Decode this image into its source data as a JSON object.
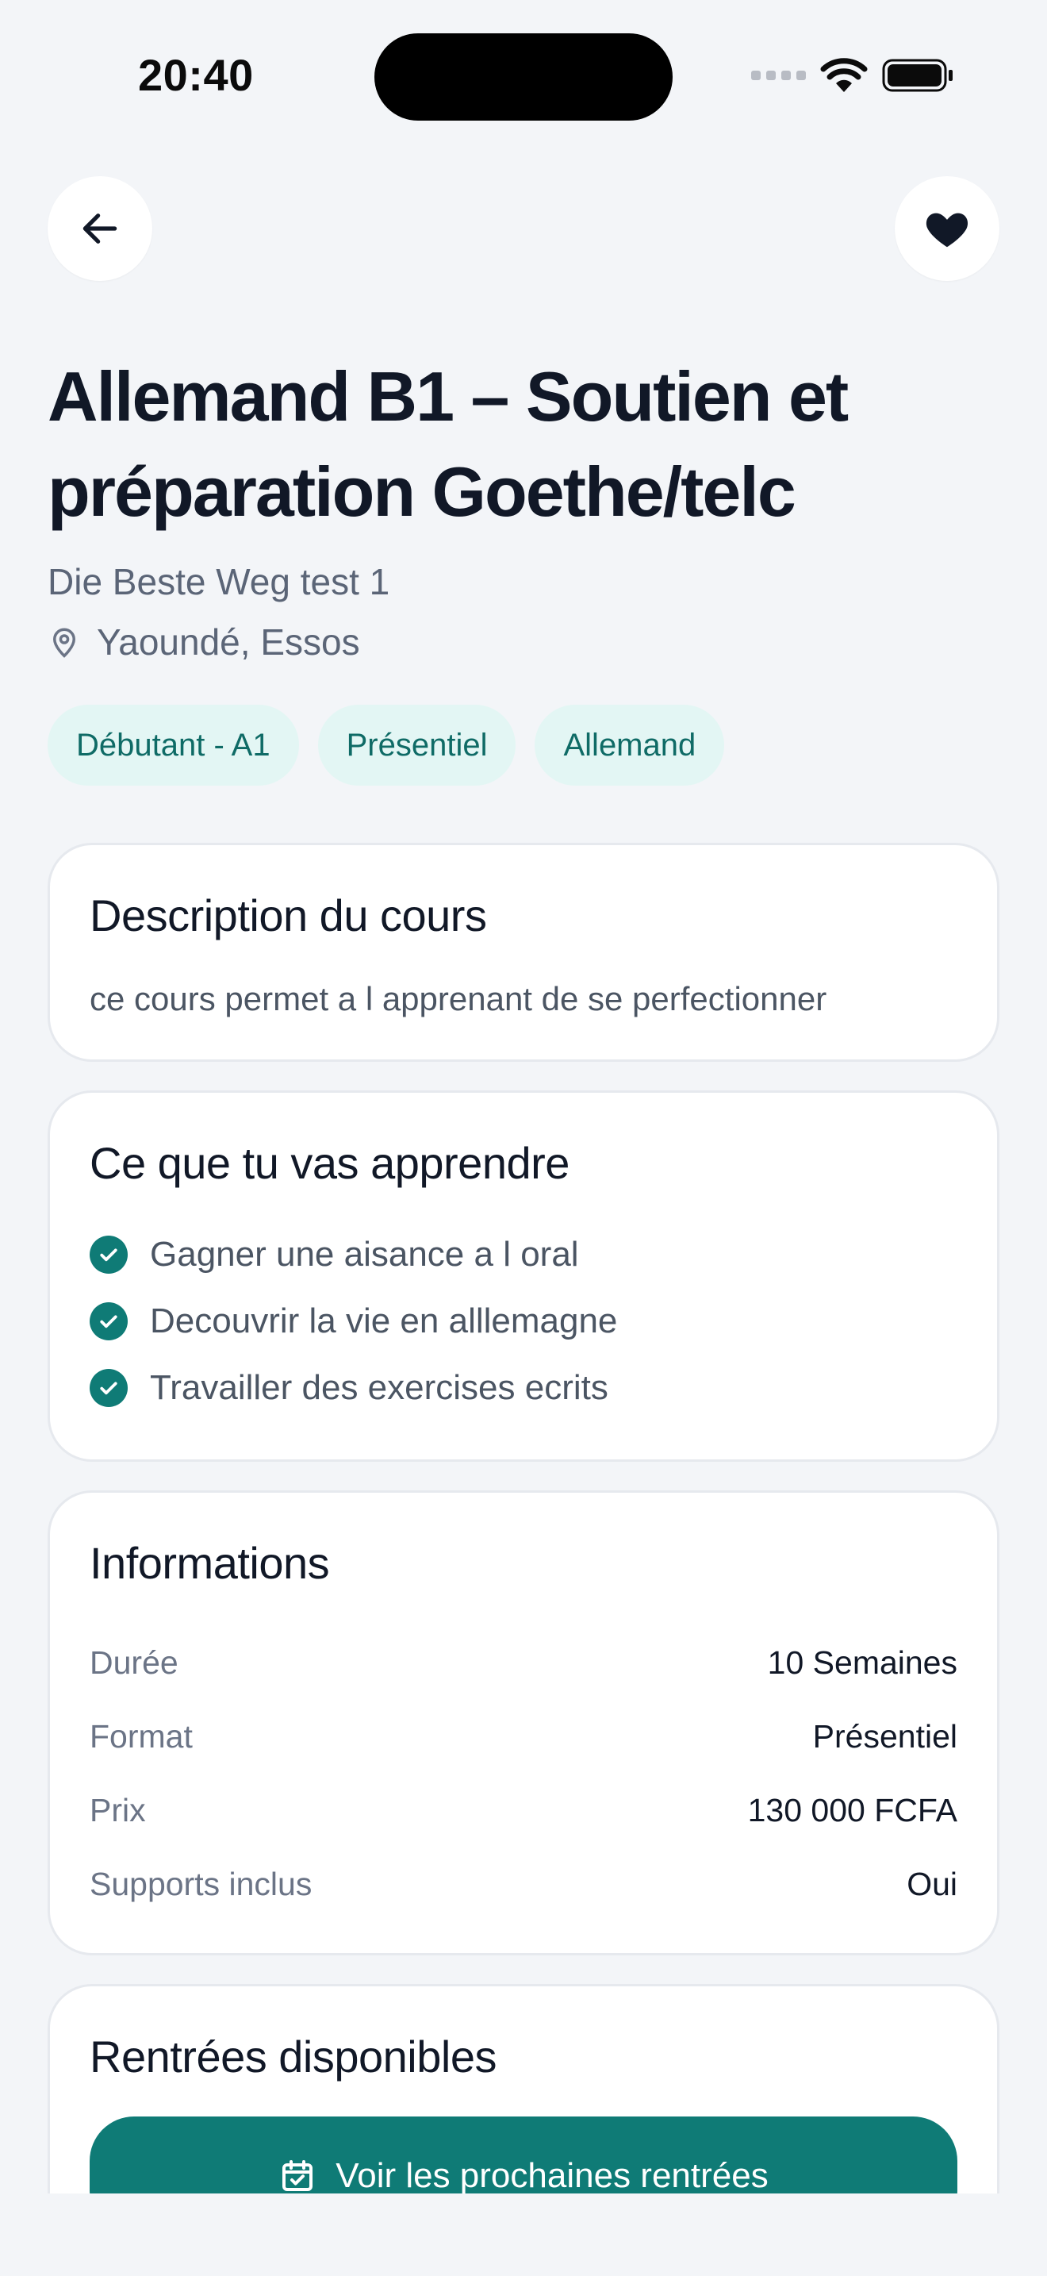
{
  "status_bar": {
    "time": "20:40"
  },
  "header": {
    "title": "Allemand B1 – Soutien et préparation Goethe/telc",
    "provider": "Die Beste Weg test 1",
    "location": "Yaoundé, Essos"
  },
  "tags": [
    "Débutant - A1",
    "Présentiel",
    "Allemand"
  ],
  "description": {
    "title": "Description du cours",
    "text": "ce cours permet a l apprenant de se perfectionner"
  },
  "learn": {
    "title": "Ce que tu vas apprendre",
    "items": [
      "Gagner une aisance a l oral",
      "Decouvrir la vie en alllemagne",
      "Travailler des exercises ecrits"
    ]
  },
  "info": {
    "title": "Informations",
    "rows": [
      {
        "label": "Durée",
        "value": "10 Semaines"
      },
      {
        "label": "Format",
        "value": "Présentiel"
      },
      {
        "label": "Prix",
        "value": "130 000 FCFA"
      },
      {
        "label": "Supports inclus",
        "value": "Oui"
      }
    ]
  },
  "rentrees": {
    "title": "Rentrées disponibles",
    "button_label": "Voir les prochaines rentrées"
  },
  "icons": {
    "back": "arrow-left-icon",
    "favorite": "heart-icon",
    "location": "map-pin-icon",
    "check": "check-circle-icon",
    "calendar": "calendar-check-icon"
  },
  "colors": {
    "accent": "#0f7b76",
    "tag_bg": "#e3f6f4",
    "tag_text": "#0f6b66"
  }
}
